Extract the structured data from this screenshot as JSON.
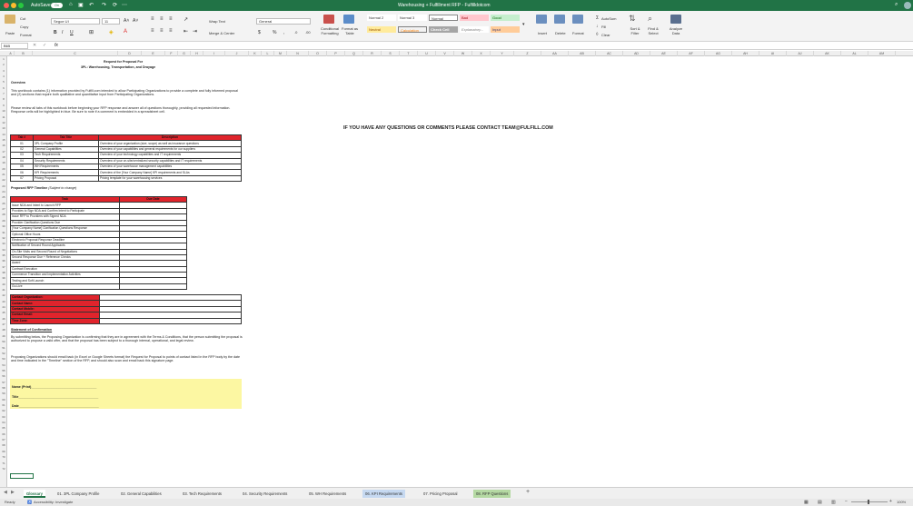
{
  "window": {
    "autosave": "AutoSave",
    "autosave_state": "On",
    "title": "Warehousing + Fulfillment RFP - Fulfilldotcom"
  },
  "ribbon": {
    "paste": "Paste",
    "cut": "Cut",
    "copy": "Copy",
    "format": "Format",
    "font": "Segoe UI",
    "size": "11",
    "number_format": "General",
    "wrap": "Wrap Text",
    "merge": "Merge & Center",
    "styles": [
      "Normal 2",
      "Normal 3",
      "Normal",
      "Bad",
      "Good",
      "Neutral",
      "Calculation",
      "Check Cell",
      "Explanatory...",
      "Input"
    ],
    "conditional": "Conditional Formatting",
    "format_table": "Format as Table",
    "insert": "Insert",
    "delete": "Delete",
    "format_cells": "Format",
    "autosum": "AutoSum",
    "fill": "Fill",
    "clear": "Clear",
    "sort": "Sort & Filter",
    "find": "Find & Select",
    "analyze": "Analyze Data"
  },
  "formula_bar": {
    "name_box": "B65",
    "fx": "fx",
    "content": ""
  },
  "columns": [
    "A",
    "B",
    "C",
    "D",
    "E",
    "F",
    "G",
    "H",
    "I",
    "J",
    "K",
    "L",
    "M",
    "N",
    "O",
    "P",
    "Q",
    "R",
    "S",
    "T",
    "U",
    "V",
    "W",
    "X",
    "Y",
    "Z",
    "AA",
    "AB",
    "AC",
    "AD",
    "AE",
    "AF",
    "AG",
    "AH",
    "AI",
    "AJ",
    "AK",
    "AL",
    "AM"
  ],
  "sheet": {
    "title1": "Request for Proposal For",
    "title2": "3PL: Warehousing, Transportation, and Drayage",
    "overview_h": "Overview",
    "overview1": "This workbook contains (1) information provided by Fulfill.com intended to allow Participating Organizations to provide a complete and fully informed proposal and (2) sections that require both qualitative and quantitative input from Participating Organizations.",
    "overview2": "Please review all tabs of this workbook before beginning your RFP response and answer all of questions thoroughly, providing all requested information. Response cells will be highlighted in blue. Be sure to note if a comment is embedded in a spreadsheet cell.",
    "contact_banner": "IF YOU HAVE ANY QUESTIONS OR COMMENTS PLEASE CONTACT TEAM@FULFILL.COM",
    "tabs_header": [
      "Tab #",
      "Tab Title",
      "Description"
    ],
    "tabs_rows": [
      [
        "01",
        "3PL Company Profile",
        "Overview of your organization (size, scope) as well as insurance questions"
      ],
      [
        "02",
        "General Capabilities",
        "Overview of your capabilities and general requirements for our suppliers"
      ],
      [
        "03",
        "Tech Requirements",
        "Overview of your technology capabilities and IT requirements"
      ],
      [
        "04",
        "Security Requirements",
        "Overview of your on-site/centralized security capabilities and IT requirements"
      ],
      [
        "05",
        "WH Requirements",
        "Overview of your warehouse management capabilities"
      ],
      [
        "06",
        "KPI Requirements",
        "Overview of the [Your Company Name] KPI requirements and SLAs"
      ],
      [
        "07",
        "Pricing Proposal",
        "Pricing template for your warehousing services"
      ]
    ],
    "timeline_h": "Proposed RFP Timeline",
    "timeline_note": "(Subject to change)",
    "timeline_header": [
      "Task",
      "Due Date"
    ],
    "timeline_rows": [
      "Issue NDA and Intent to Launch RFP",
      "Provides to Sign NDA and Confirm Intent to Participate",
      "Issue RFP to Providers with Signed NDA",
      "Provider Clarification Questions Due",
      "[Your Company Name] Clarification Questions Response",
      "Optional Office Hours",
      "Electronic Proposal Response Deadline",
      "Notification of Second Round Applicants",
      "On-Site Visits and Second Round of Negotiations",
      "Second Response Due + Reference Checks",
      "Award",
      "Contract Execution",
      "Commence Transition and Implementation Activities",
      "Testing and Soft Launch",
      "Go-Live"
    ],
    "contact_labels": [
      "Contact Organization:",
      "Contact Name:",
      "Contact Mobile:",
      "Contact Email:",
      "Time Zone:"
    ],
    "confirm_h": "Statement of Confirmation",
    "confirm1": "By submitting below, the Proposing Organization is confirming that they are in agreement with the Terms & Conditions, that the person submitting the proposal is authorized to propose a valid offer, and that the proposal has been subject to a thorough internal, operational, and legal review.",
    "confirm2": "Proposing Organizations should email back (in Excel or Google Sheets format) the Request for Proposal to points of contact listed in the RFP body by the date and time indicated in the \"Timeline\" section of the RFP, and should also scan and email back this signature page.",
    "sig_name": "Name (Print)____________________________________",
    "sig_title": "Title____________________________________________",
    "sig_date": "Date____________________________________________"
  },
  "tabs": [
    "Glossary",
    "01. 3PL Company Profile",
    "02. General Capabilities",
    "03. Tech Requirements",
    "04. Security Requirements",
    "05. WH Requirements",
    "06. KPI Requirements",
    "07. Pricing Proposal",
    "08. RFP Questions"
  ],
  "status": {
    "ready": "Ready",
    "accessibility": "Accessibility: Investigate",
    "zoom": "100%"
  },
  "colors": {
    "excel_green": "#217346",
    "header_red": "#e0242c",
    "sign_yellow": "#fcf7a2",
    "kpi_tab": "#c6d9f1",
    "rfp_tab": "#b5d9a3"
  }
}
